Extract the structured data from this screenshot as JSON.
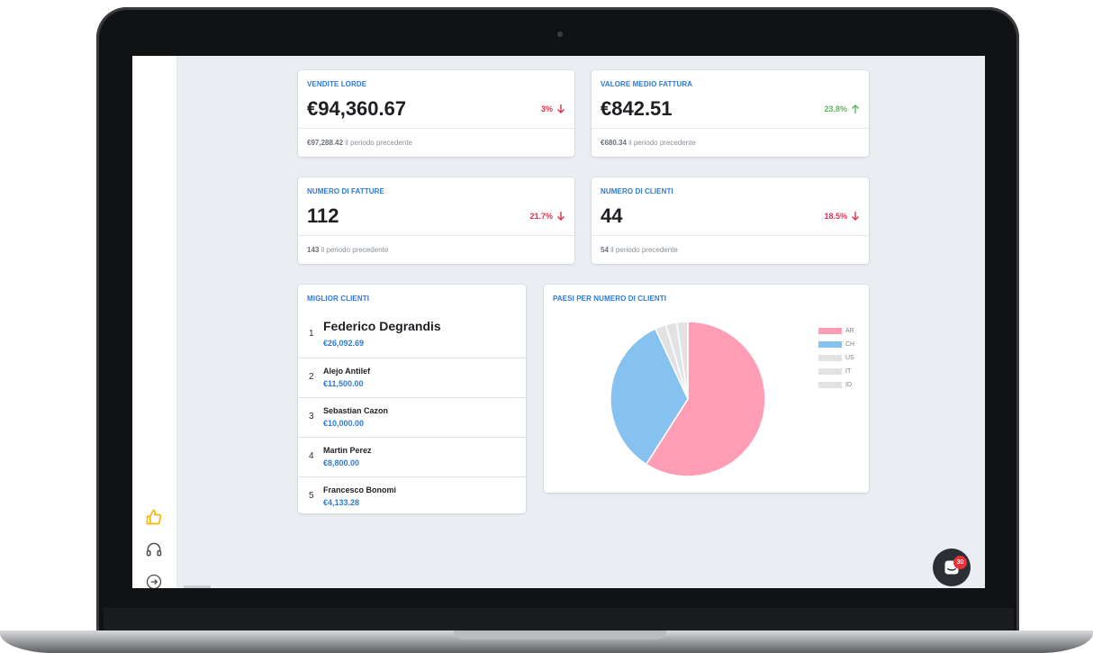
{
  "kpis": [
    {
      "title": "VENDITE LORDE",
      "value": "€94,360.67",
      "change": "3%",
      "direction": "down",
      "previous_value": "€97,288.42",
      "previous_label": "il periodo precedente"
    },
    {
      "title": "VALORE MEDIO FATTURA",
      "value": "€842.51",
      "change": "23.8%",
      "direction": "up",
      "previous_value": "€680.34",
      "previous_label": "il periodo precedente"
    },
    {
      "title": "NUMERO DI FATTURE",
      "value": "112",
      "change": "21.7%",
      "direction": "down",
      "previous_value": "143",
      "previous_label": "il periodo precedente"
    },
    {
      "title": "NUMERO DI CLIENTI",
      "value": "44",
      "change": "18.5%",
      "direction": "down",
      "previous_value": "54",
      "previous_label": "il periodo precedente"
    }
  ],
  "top_clients": {
    "title": "MIGLIOR CLIENTI",
    "items": [
      {
        "rank": "1",
        "name": "Federico Degrandis",
        "amount": "€26,092.69"
      },
      {
        "rank": "2",
        "name": "Alejo Antilef",
        "amount": "€11,500.00"
      },
      {
        "rank": "3",
        "name": "Sebastian Cazon",
        "amount": "€10,000.00"
      },
      {
        "rank": "4",
        "name": "Martin Perez",
        "amount": "€8,800.00"
      },
      {
        "rank": "5",
        "name": "Francesco Bonomi",
        "amount": "€4,133.28"
      }
    ]
  },
  "chart_title": "PAESI PER NUMERO DI CLIENTI",
  "chart_data": {
    "type": "pie",
    "title": "PAESI PER NUMERO DI CLIENTI",
    "categories": [
      "AR",
      "CH",
      "US",
      "IT",
      "ID"
    ],
    "values": [
      59.1,
      34.1,
      2.3,
      2.3,
      2.3
    ],
    "colors": [
      "#ff9db4",
      "#86c2ef",
      "#e2e2e2",
      "#e2e2e2",
      "#e2e2e2"
    ],
    "legend": "right"
  },
  "colors": {
    "accent": "#2e7ad6",
    "negative": "#e0304a",
    "positive": "#5cb85c",
    "background": "#eaeef3"
  },
  "sidebar": {
    "icons": [
      "thumbs-up-icon",
      "headset-icon",
      "logout-icon"
    ]
  },
  "chat": {
    "badge": "30",
    "icon": "chat-icon"
  }
}
